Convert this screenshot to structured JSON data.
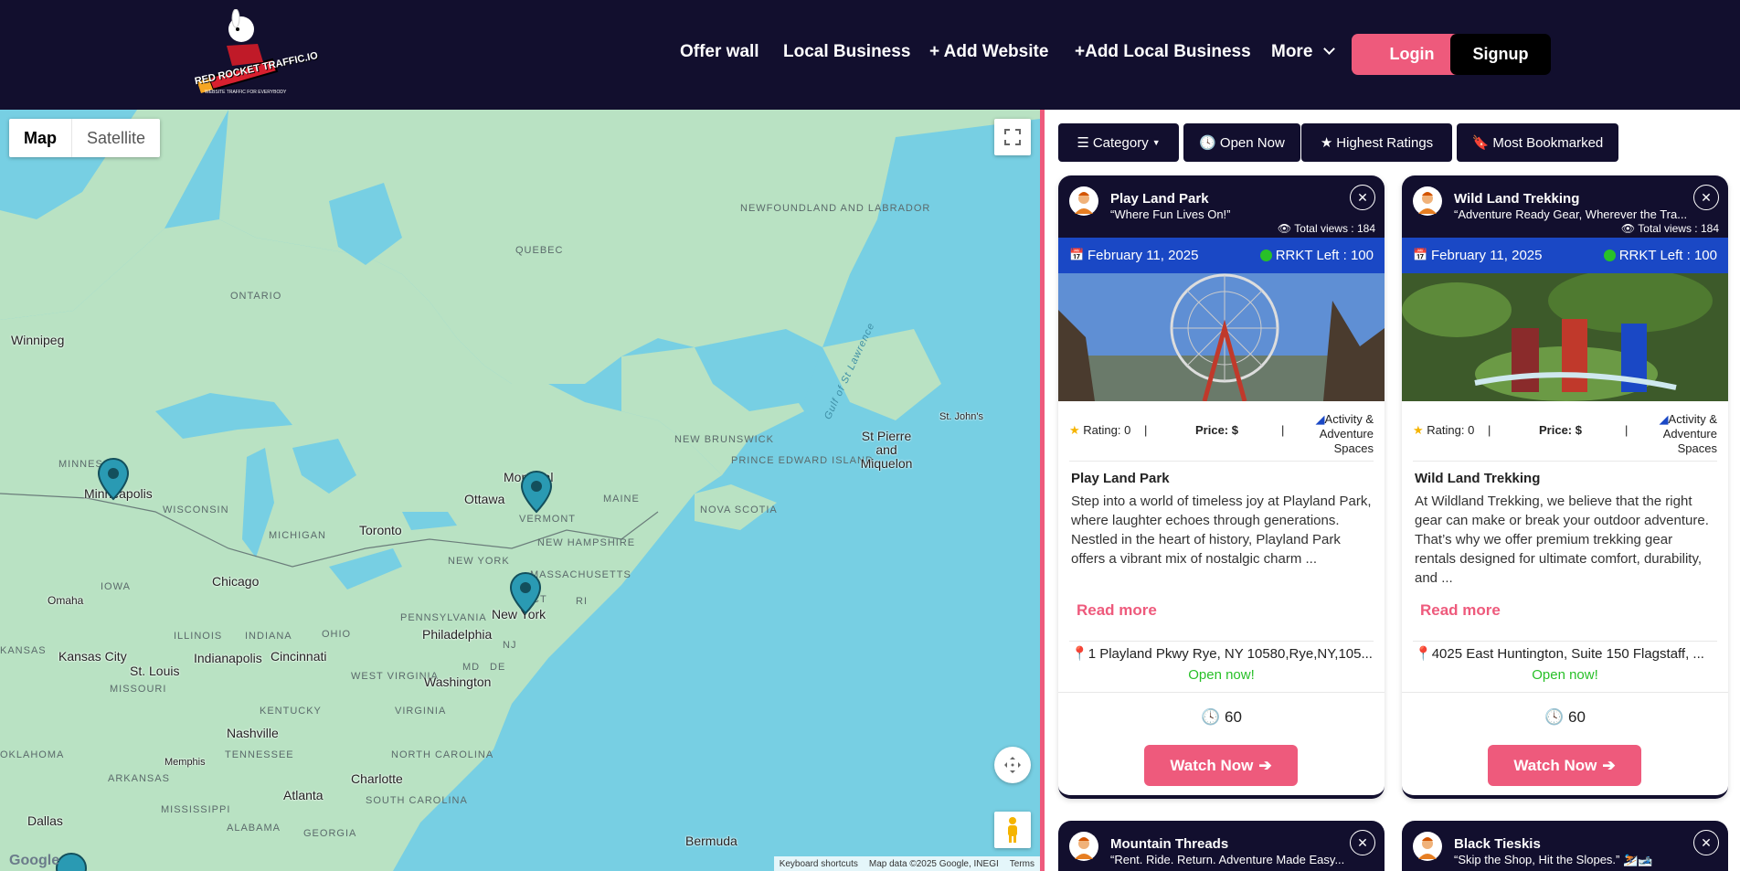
{
  "nav": {
    "logo_text": "RED ROCKET TRAFFIC.IO",
    "logo_sub": "WEBSITE TRAFFIC FOR EVERYBODY",
    "links": [
      "Offer wall",
      "Local Business",
      "+ Add Website",
      "+Add Local Business",
      "More"
    ],
    "login": "Login",
    "signup": "Signup"
  },
  "map": {
    "type_map": "Map",
    "type_satellite": "Satellite",
    "regions": [
      "NEWFOUNDLAND AND LABRADOR",
      "QUEBEC",
      "ONTARIO",
      "NEW BRUNSWICK",
      "PRINCE EDWARD ISLAND",
      "NOVA SCOTIA",
      "MAINE",
      "VERMONT",
      "NEW HAMPSHIRE",
      "MASSACHUSETTS",
      "NEW YORK",
      "MINNESOTA",
      "WISCONSIN",
      "MICHIGAN",
      "IOWA",
      "ILLINOIS",
      "INDIANA",
      "OHIO",
      "PENNSYLVANIA",
      "NJ",
      "CT",
      "RI",
      "MD",
      "DE",
      "WEST VIRGINIA",
      "VIRGINIA",
      "KENTUCKY",
      "TENNESSEE",
      "NORTH CAROLINA",
      "SOUTH CAROLINA",
      "GEORGIA",
      "ALABAMA",
      "MISSISSIPPI",
      "ARKANSAS",
      "OKLAHOMA",
      "MISSOURI",
      "KANSAS"
    ],
    "cities": [
      "Winnipeg",
      "Minneapolis",
      "Toronto",
      "Ottawa",
      "Montreal",
      "Chicago",
      "Omaha",
      "Kansas City",
      "St. Louis",
      "Indianapolis",
      "Cincinnati",
      "Philadelphia",
      "New York",
      "Washington",
      "Nashville",
      "Memphis",
      "Charlotte",
      "Atlanta",
      "Dallas",
      "St Pierre and Miquelon",
      "St. John's",
      "Bermuda",
      "Gulf of St Lawrence"
    ],
    "attribution": [
      "Keyboard shortcuts",
      "Map data ©2025 Google, INEGI",
      "Terms"
    ],
    "google": "Google"
  },
  "filters": [
    "Category",
    "Open Now",
    "Highest Ratings",
    "Most Bookmarked"
  ],
  "cards": [
    {
      "title": "Play Land Park",
      "tagline": "“Where Fun Lives On!”",
      "views": "Total views : 184",
      "date": "February 11, 2025",
      "rrkt": "RRKT Left : 100",
      "rating": "Rating: 0",
      "price": "Price: $",
      "category": "Activity & Adventure Spaces",
      "name": "Play Land Park",
      "description": "Step into a world of timeless joy at Playland Park, where laughter echoes through generations. Nestled in the heart of history, Playland Park offers a vibrant mix of nostalgic charm ...",
      "read_more": "Read more",
      "address": "1 Playland Pkwy Rye, NY 10580,Rye,NY,105...",
      "status": "Open now!",
      "count": "60",
      "watch": "Watch Now"
    },
    {
      "title": "Wild Land Trekking",
      "tagline": "“Adventure Ready Gear, Wherever the Tra...",
      "views": "Total views : 184",
      "date": "February 11, 2025",
      "rrkt": "RRKT Left : 100",
      "rating": "Rating: 0",
      "price": "Price: $",
      "category": "Activity & Adventure Spaces",
      "name": "Wild Land Trekking",
      "description": "At Wildland Trekking, we believe that the right gear can make or break your outdoor adventure. That’s why we offer premium trekking gear rentals designed for ultimate comfort, durability, and ...",
      "read_more": "Read more",
      "address": "4025 East Huntington, Suite 150 Flagstaff, ...",
      "status": "Open now!",
      "count": "60",
      "watch": "Watch Now"
    }
  ],
  "cards_next": [
    {
      "title": "Mountain Threads",
      "tagline": "“Rent. Ride. Return. Adventure Made Easy..."
    },
    {
      "title": "Black Tieskis",
      "tagline": "“Skip the Shop, Hit the Slopes.” ⛷️🎿"
    }
  ],
  "colors": {
    "navy": "#120f2e",
    "pink": "#ee5a7c",
    "blue": "#1a48c5",
    "green": "#28c028",
    "water": "#77cfe3",
    "land": "#b9e2c3"
  }
}
